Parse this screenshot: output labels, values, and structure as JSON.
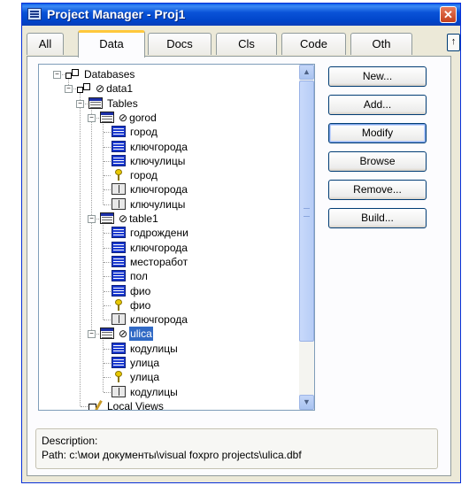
{
  "window": {
    "title": "Project Manager - Proj1",
    "close_glyph": "✕"
  },
  "tabs": [
    "All",
    "Data",
    "Docs",
    "Cls",
    "Code",
    "Oth"
  ],
  "tab_scroll_glyph": "↑",
  "tree": [
    {
      "text": "Databases",
      "icon": "database-icon",
      "level": 0,
      "toggle": "−",
      "null": false
    },
    {
      "text": "data1",
      "icon": "database-icon",
      "level": 1,
      "toggle": "−",
      "null": true
    },
    {
      "text": "Tables",
      "icon": "table-icon",
      "level": 2,
      "toggle": "−",
      "null": false
    },
    {
      "text": "gorod",
      "icon": "table-icon",
      "level": 3,
      "toggle": "−",
      "null": true
    },
    {
      "text": "город",
      "icon": "field-icon",
      "level": 4
    },
    {
      "text": "ключгорода",
      "icon": "field-icon",
      "level": 4
    },
    {
      "text": "ключулицы",
      "icon": "field-icon",
      "level": 4
    },
    {
      "text": "город",
      "icon": "key-icon",
      "level": 4
    },
    {
      "text": "ключгорода",
      "icon": "index-icon",
      "level": 4
    },
    {
      "text": "ключулицы",
      "icon": "index-icon",
      "level": 4
    },
    {
      "text": "table1",
      "icon": "table-icon",
      "level": 3,
      "toggle": "−",
      "null": true
    },
    {
      "text": "годрождени",
      "icon": "field-icon",
      "level": 4
    },
    {
      "text": "ключгорода",
      "icon": "field-icon",
      "level": 4
    },
    {
      "text": "месторабот",
      "icon": "field-icon",
      "level": 4
    },
    {
      "text": "пол",
      "icon": "field-icon",
      "level": 4
    },
    {
      "text": "фио",
      "icon": "field-icon",
      "level": 4
    },
    {
      "text": "фио",
      "icon": "key-icon",
      "level": 4
    },
    {
      "text": "ключгорода",
      "icon": "index-icon",
      "level": 4
    },
    {
      "text": "ulica",
      "icon": "table-icon",
      "level": 3,
      "toggle": "−",
      "null": true,
      "selected": true
    },
    {
      "text": "кодулицы",
      "icon": "field-icon",
      "level": 4
    },
    {
      "text": "улица",
      "icon": "field-icon",
      "level": 4
    },
    {
      "text": "улица",
      "icon": "key-icon",
      "level": 4
    },
    {
      "text": "кодулицы",
      "icon": "index-icon",
      "level": 4
    },
    {
      "text": "Local Views",
      "icon": "view-icon",
      "level": 2
    }
  ],
  "null_glyph": "⊘",
  "buttons": [
    {
      "label": "New...",
      "focused": false
    },
    {
      "label": "Add...",
      "focused": false
    },
    {
      "label": "Modify",
      "focused": true
    },
    {
      "label": "Browse",
      "focused": false
    },
    {
      "label": "Remove...",
      "focused": false
    },
    {
      "label": "Build...",
      "focused": false
    }
  ],
  "scroll": {
    "up": "▲",
    "down": "▼"
  },
  "description": {
    "label": "Description:",
    "path": "Path: c:\\мои документы\\visual foxpro projects\\ulica.dbf"
  }
}
